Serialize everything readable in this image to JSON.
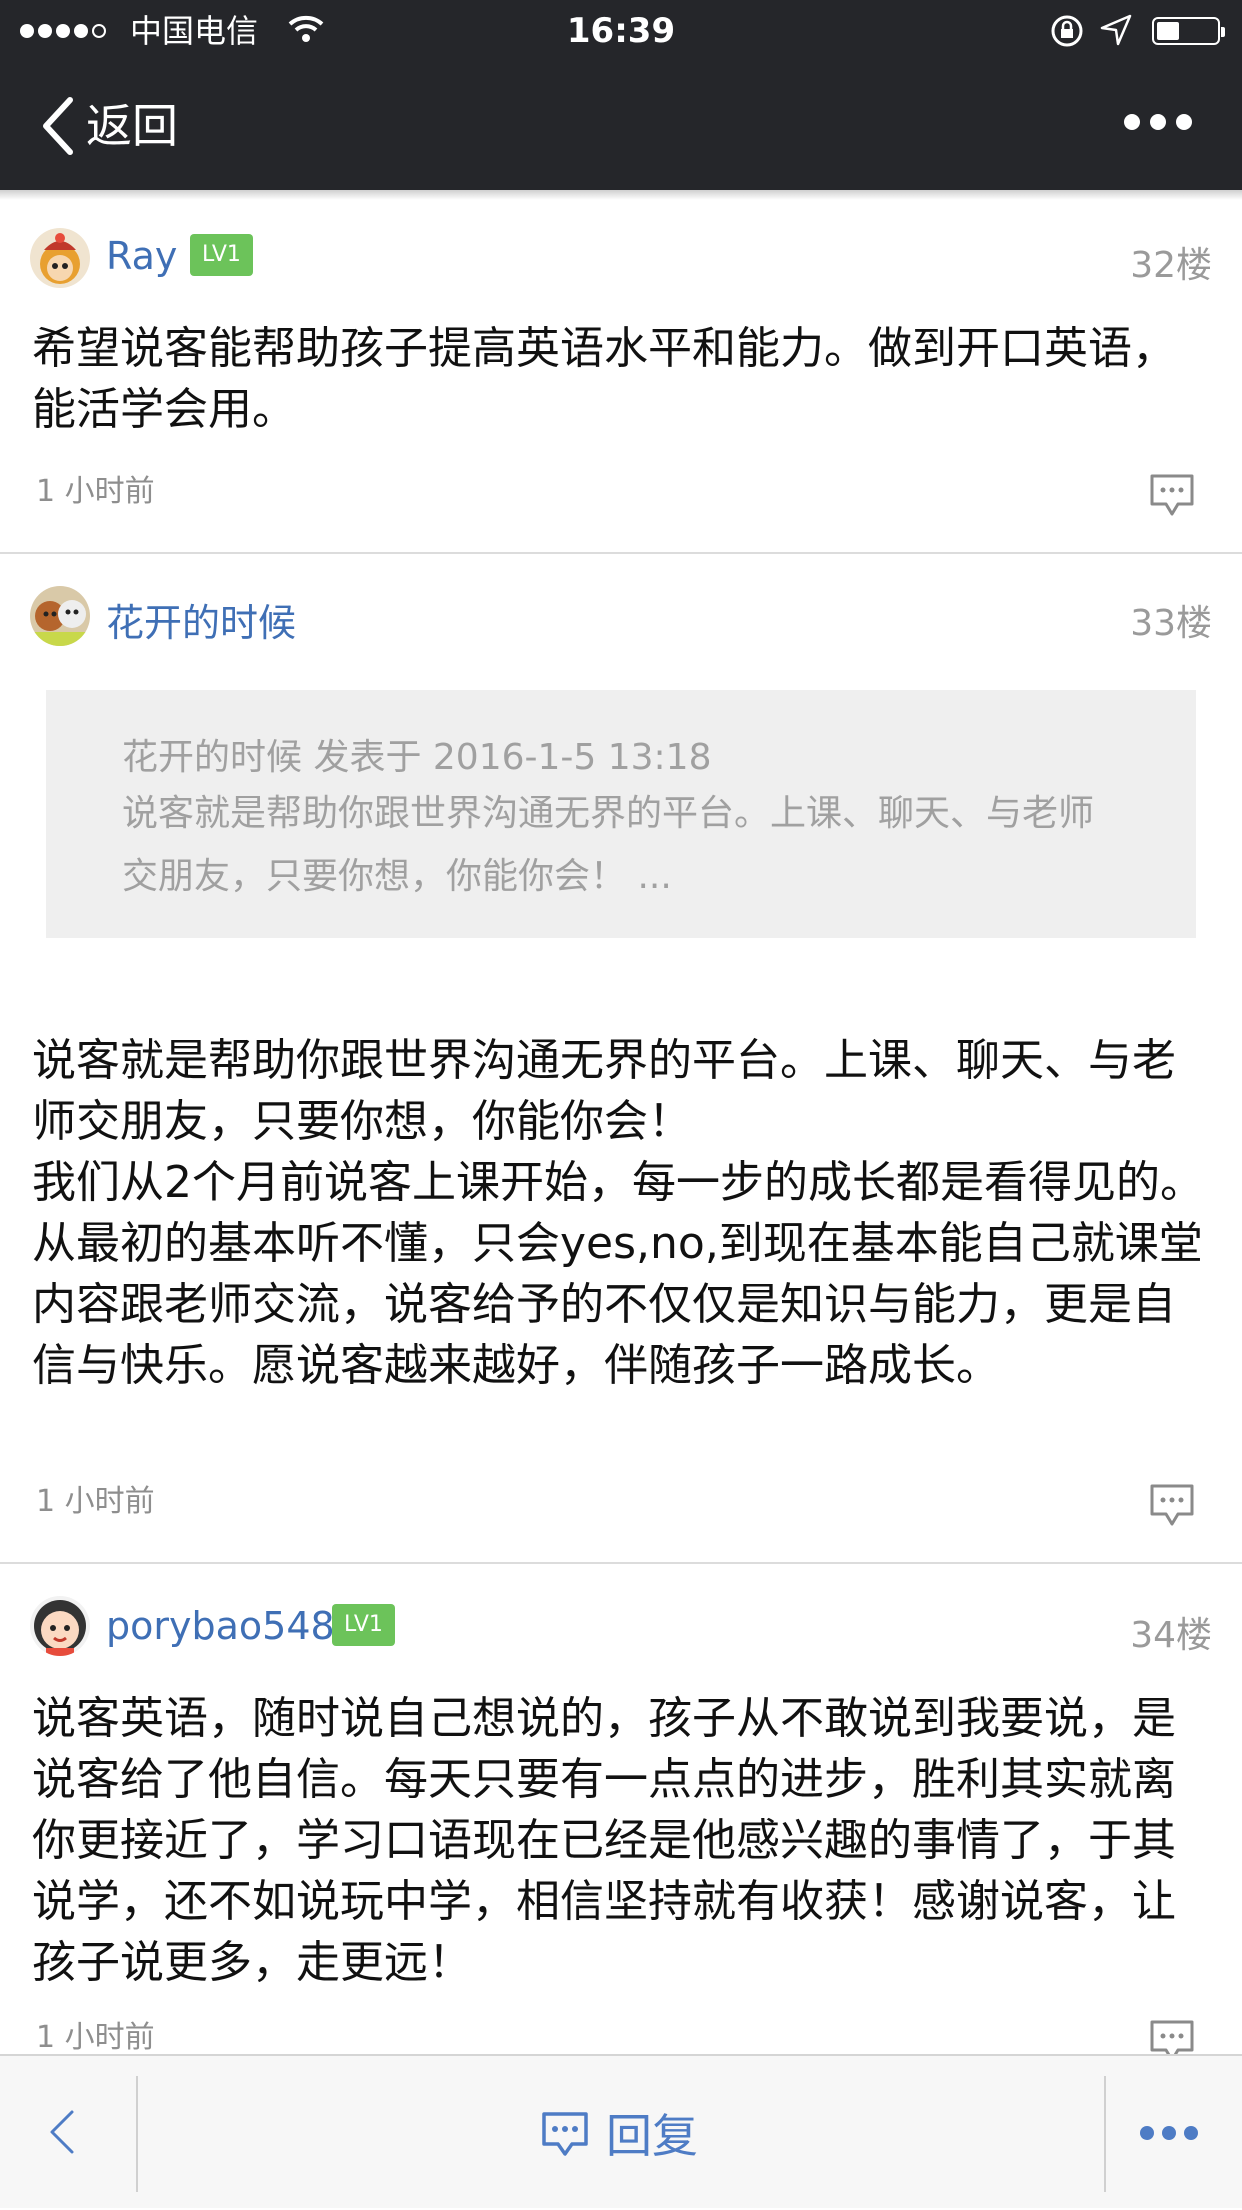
{
  "status_bar": {
    "carrier": "中国电信",
    "time": "16:39"
  },
  "nav": {
    "back_label": "返回"
  },
  "posts": [
    {
      "username": "Ray",
      "level": "LV1",
      "floor": "32楼",
      "content": "希望说客能帮助孩子提高英语水平和能力。做到开口英语，能活学会用。",
      "time_ago": "1 小时前"
    },
    {
      "username": "花开的时候",
      "floor": "33楼",
      "quote": {
        "header": "花开的时候 发表于 2016-1-5 13:18",
        "text": "说客就是帮助你跟世界沟通无界的平台。上课、聊天、与老师交朋友，只要你想，你能你会！ ..."
      },
      "content_lines": [
        "说客就是帮助你跟世界沟通无界的平台。上课、聊天、与老师交朋友，只要你想，你能你会！",
        "我们从2个月前说客上课开始，每一步的成长都是看得见的。从最初的基本听不懂，只会yes,no,到现在基本能自己就课堂内容跟老师交流，说客给予的不仅仅是知识与能力，更是自信与快乐。愿说客越来越好，伴随孩子一路成长。"
      ],
      "time_ago": "1 小时前"
    },
    {
      "username": "porybao548",
      "level": "LV1",
      "floor": "34楼",
      "content": "说客英语，随时说自己想说的，孩子从不敢说到我要说，是说客给了他自信。每天只要有一点点的进步，胜利其实就离你更接近了，学习口语现在已经是他感兴趣的事情了，于其说学，还不如说玩中学，相信坚持就有收获！感谢说客，让孩子说更多，走更远！",
      "time_ago": "1 小时前"
    }
  ],
  "toolbar": {
    "reply_label": "回复"
  }
}
